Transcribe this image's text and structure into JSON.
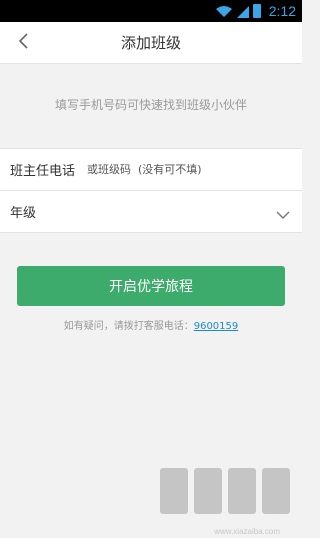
{
  "status_bar": {
    "time": "2:12",
    "icons": [
      "wifi-icon",
      "signal-icon",
      "battery-icon"
    ]
  },
  "header": {
    "title": "添加班级",
    "back_icon": "chevron-left-icon"
  },
  "hint": "填写手机号码可快速找到班级小伙伴",
  "form": {
    "teacher_phone": {
      "label": "班主任电话",
      "placeholder": "或班级码  (没有可不填)",
      "value": ""
    },
    "grade": {
      "label": "年级",
      "value": "",
      "icon": "chevron-down-icon"
    }
  },
  "submit": {
    "label": "开启优学旅程"
  },
  "help": {
    "text": "如有疑问，请拨打客服电话：",
    "phone": "9600159"
  },
  "watermark": {
    "text": "www.xiazaiba.com"
  },
  "colors": {
    "accent_green": "#3dab6b",
    "link_blue": "#1e88d2",
    "status_blue": "#3aa6e8"
  }
}
